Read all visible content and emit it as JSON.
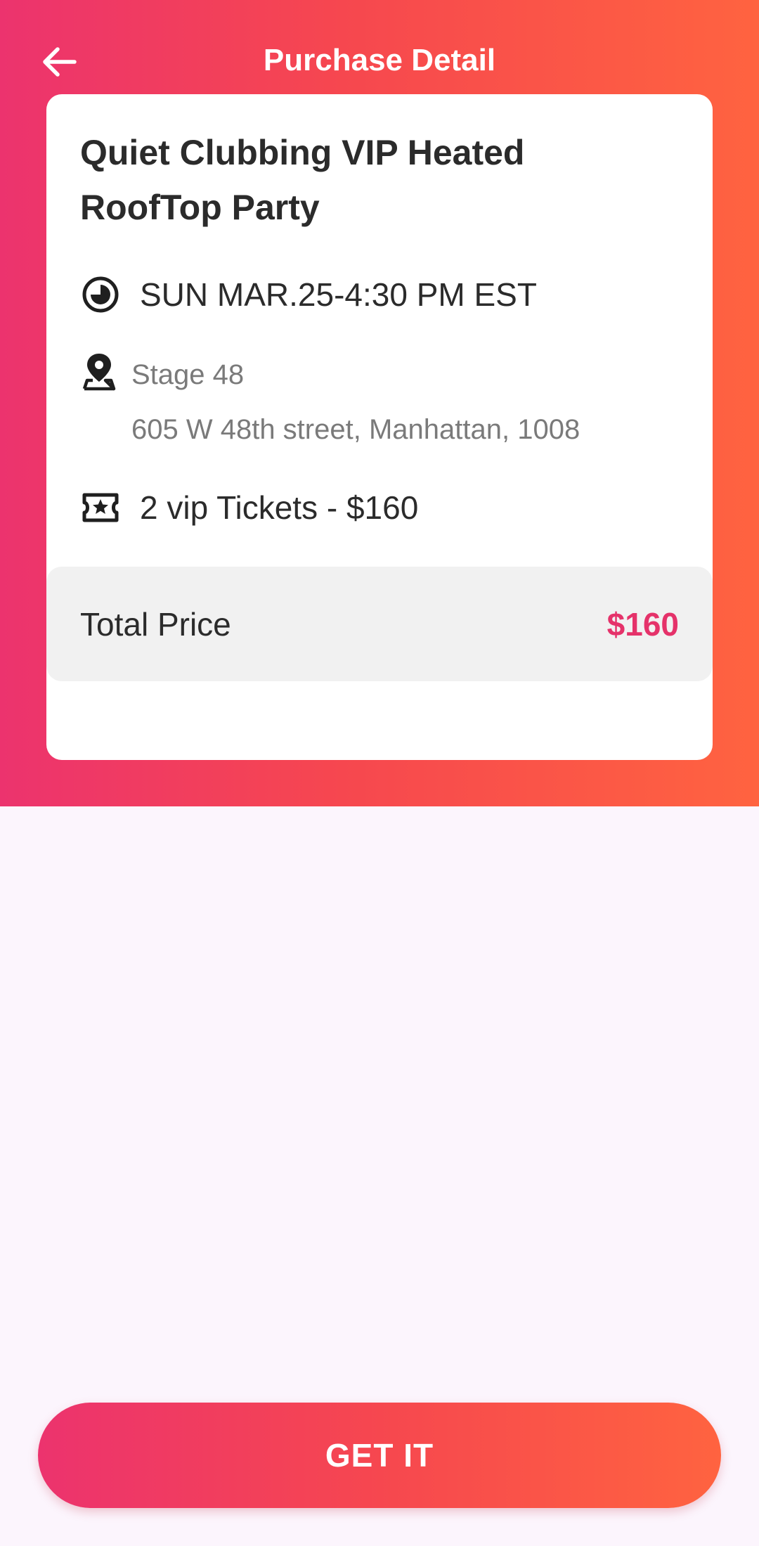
{
  "app_bar": {
    "title": "Purchase Detail",
    "back_icon": "arrow-left-icon"
  },
  "event": {
    "title": "Quiet Clubbing VIP Heated RoofTop Party",
    "datetime": "SUN MAR.25-4:30 PM EST",
    "datetime_icon": "clock-icon",
    "venue_name": "Stage 48",
    "venue_address": "605 W 48th street, Manhattan, 1008",
    "venue_icon": "location-pin-icon",
    "tickets": "2 vip Tickets - $160",
    "tickets_icon": "ticket-star-icon"
  },
  "summary": {
    "total_label": "Total Price",
    "total_value": "$160"
  },
  "cta": {
    "label": "GET IT"
  },
  "colors": {
    "gradient_start": "#EC336E",
    "gradient_end": "#FF6340",
    "price_accent": "#E5326A",
    "page_background": "#FCF5FD",
    "card_background": "#FFFFFF",
    "total_bar_background": "#F1F1F1"
  }
}
